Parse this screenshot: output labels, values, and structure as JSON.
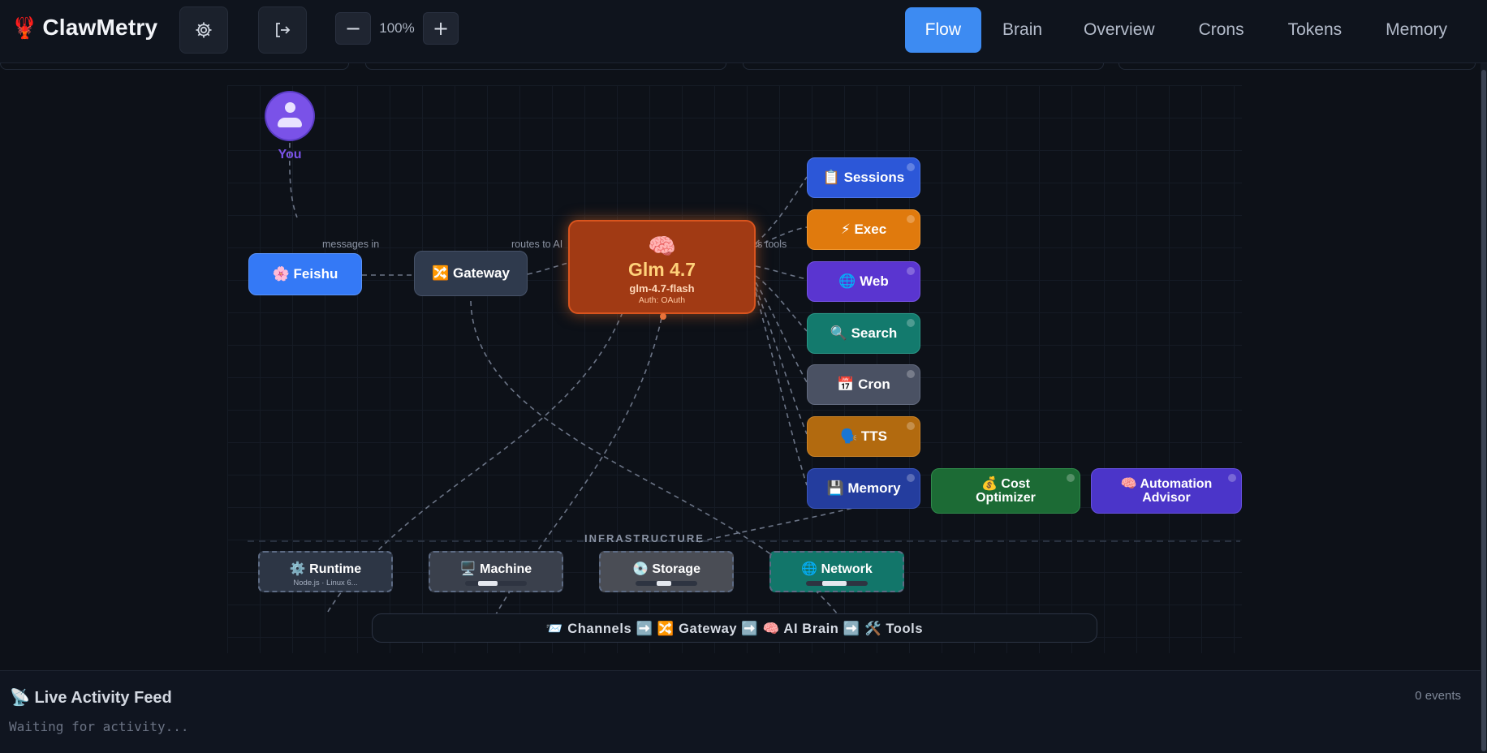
{
  "app": {
    "logo_icon": "lobster-icon",
    "name": "ClawMetry"
  },
  "toolbar": {
    "settings_icon": "gear-icon",
    "logout_icon": "logout-icon",
    "zoom_out": "−",
    "zoom_level": "100%",
    "zoom_in": "+"
  },
  "tabs": [
    {
      "label": "Flow",
      "active": true
    },
    {
      "label": "Brain"
    },
    {
      "label": "Overview"
    },
    {
      "label": "Crons"
    },
    {
      "label": "Tokens"
    },
    {
      "label": "Memory"
    }
  ],
  "flow": {
    "user": {
      "label": "You"
    },
    "edge_labels": {
      "messages_in": "messages in",
      "routes_to_ai": "routes to AI",
      "uses_tools": "uses tools"
    },
    "channel": {
      "label": "🌸 Feishu",
      "color": "#3479f6"
    },
    "gateway": {
      "label": "🔀 Gateway",
      "color": "#2f3a4d"
    },
    "brain": {
      "emoji": "🧠",
      "title": "Glm 4.7",
      "model": "glm-4.7-flash",
      "auth": "Auth: OAuth",
      "color": "#a13a14"
    },
    "tools": [
      {
        "label": "📋 Sessions",
        "color": "#2c57d8"
      },
      {
        "label": "⚡ Exec",
        "color": "#e07a0d"
      },
      {
        "label": "🌐 Web",
        "color": "#5a35d0"
      },
      {
        "label": "🔍 Search",
        "color": "#137a6d"
      },
      {
        "label": "📅 Cron",
        "color": "#4a5163"
      },
      {
        "label": "🗣️ TTS",
        "color": "#b26a0f"
      },
      {
        "label": "💾 Memory",
        "color": "#243d9e"
      }
    ],
    "extras": [
      {
        "line1": "💰 Cost",
        "line2": "Optimizer",
        "color": "#1c6b35"
      },
      {
        "line1": "🧠 Automation",
        "line2": "Advisor",
        "color": "#4b35c9"
      }
    ],
    "infrastructure_label": "INFRASTRUCTURE",
    "infrastructure": [
      {
        "label": "⚙️ Runtime",
        "meta": "Node.js · Linux 6...",
        "color": "#2d3645"
      },
      {
        "label": "🖥️ Machine",
        "color": "#3a404c"
      },
      {
        "label": "💿 Storage",
        "color": "#4a4d55"
      },
      {
        "label": "🌐 Network",
        "color": "#12766a"
      }
    ],
    "legend": "📨 Channels ➡️ 🔀 Gateway ➡️ 🧠 AI Brain ➡️ 🛠️ Tools"
  },
  "feed": {
    "title": "📡 Live Activity Feed",
    "count": "0 events",
    "placeholder": "Waiting for activity..."
  }
}
